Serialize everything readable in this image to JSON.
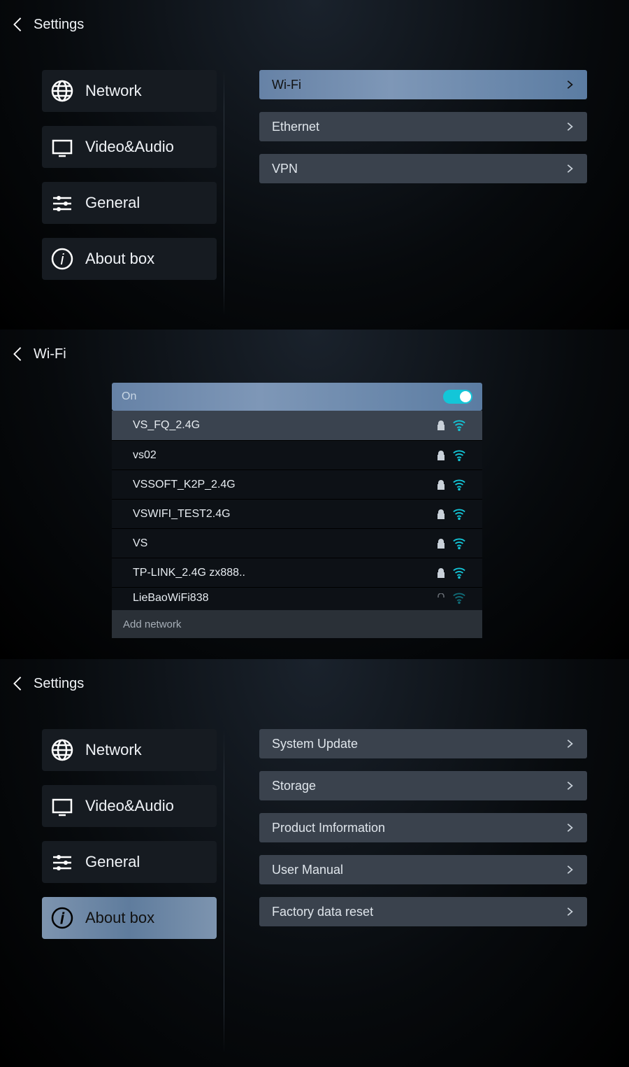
{
  "screen1": {
    "header": "Settings",
    "sidebar": [
      {
        "id": "network",
        "label": "Network",
        "selected": false
      },
      {
        "id": "video-audio",
        "label": "Video&Audio",
        "selected": false
      },
      {
        "id": "general",
        "label": "General",
        "selected": false
      },
      {
        "id": "about-box",
        "label": "About box",
        "selected": false
      }
    ],
    "rows": [
      {
        "id": "wifi",
        "label": "Wi-Fi",
        "selected": true
      },
      {
        "id": "ethernet",
        "label": "Ethernet",
        "selected": false
      },
      {
        "id": "vpn",
        "label": "VPN",
        "selected": false
      }
    ]
  },
  "screen2": {
    "header": "Wi-Fi",
    "state_label": "On",
    "enabled": true,
    "networks": [
      {
        "ssid": "VS_FQ_2.4G",
        "locked": true,
        "highlighted": true
      },
      {
        "ssid": "vs02",
        "locked": true,
        "highlighted": false
      },
      {
        "ssid": "VSSOFT_K2P_2.4G",
        "locked": true,
        "highlighted": false
      },
      {
        "ssid": "VSWIFI_TEST2.4G",
        "locked": true,
        "highlighted": false
      },
      {
        "ssid": "VS",
        "locked": true,
        "highlighted": false
      },
      {
        "ssid": "TP-LINK_2.4G zx888..",
        "locked": true,
        "highlighted": false
      },
      {
        "ssid": "LieBaoWiFi838",
        "locked": false,
        "highlighted": false
      }
    ],
    "add_label": "Add network"
  },
  "screen3": {
    "header": "Settings",
    "sidebar": [
      {
        "id": "network",
        "label": "Network",
        "selected": false
      },
      {
        "id": "video-audio",
        "label": "Video&Audio",
        "selected": false
      },
      {
        "id": "general",
        "label": "General",
        "selected": false
      },
      {
        "id": "about-box",
        "label": "About box",
        "selected": true
      }
    ],
    "rows": [
      {
        "id": "system-update",
        "label": "System Update",
        "selected": false
      },
      {
        "id": "storage",
        "label": "Storage",
        "selected": false
      },
      {
        "id": "product-info",
        "label": "Product Imformation",
        "selected": false
      },
      {
        "id": "user-manual",
        "label": "User Manual",
        "selected": false
      },
      {
        "id": "factory-reset",
        "label": "Factory data reset",
        "selected": false
      }
    ]
  }
}
